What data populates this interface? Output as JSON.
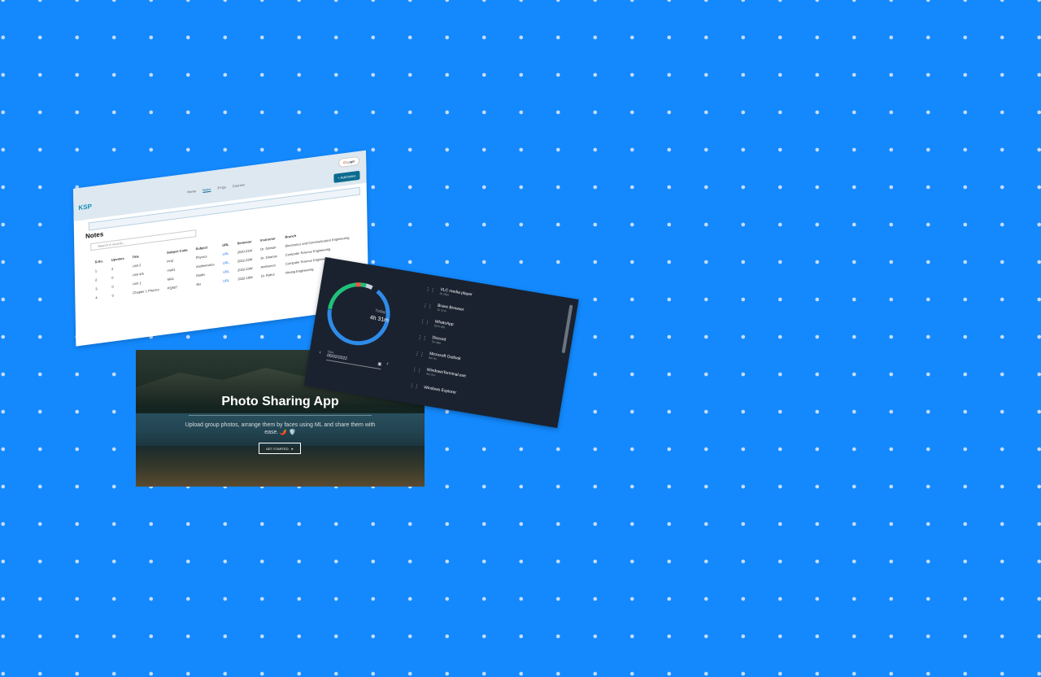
{
  "photo_app": {
    "title": "Photo Sharing App",
    "subtitle": "Upload group photos, arrange them by faces using ML and share them with ease. 🌶️ 🛡️",
    "button": "GET STARTED"
  },
  "notes_app": {
    "logo": "KSP",
    "nav": [
      "Home",
      "Notes",
      "PYQs",
      "Courses"
    ],
    "login": "Login",
    "add_button": "Add Notes",
    "page_title": "Notes",
    "search_placeholder": "Search 4 records...",
    "columns": [
      "S.No.",
      "Upvotes",
      "Title",
      "Subject Code",
      "Subject",
      "URL",
      "Semester",
      "Instructor",
      "Branch"
    ],
    "rows": [
      [
        "1.",
        "2",
        "Unit 2",
        "PH2",
        "Physics",
        "URL",
        "2020-21W",
        "Dr. Gitman",
        "Electronics and Communication Engineering"
      ],
      [
        "2.",
        "0",
        "Unit 4/5",
        "ma01",
        "mathematics",
        "URL",
        "2022-23W",
        "Dr. Ghanan",
        "Computer Science Engineering"
      ],
      [
        "3.",
        "0",
        "Unit 1",
        "MA1",
        "Maths",
        "URL",
        "2022-23W",
        "Anthumon",
        "Computer Science Engineering"
      ],
      [
        "4.",
        "0",
        "Chapter 1 Physics",
        "PQ607",
        "Bio",
        "URL",
        "2022-18W",
        "Dr. Rahul",
        "Mining Engineering"
      ]
    ]
  },
  "screentime_app": {
    "today_label": "Today",
    "total": "4h 31m",
    "date_label": "Date",
    "date_value": "05/02/2022",
    "apps": [
      {
        "name": "VLC media player",
        "time": "2h 28m"
      },
      {
        "name": "Brave Browser",
        "time": "1h 21m"
      },
      {
        "name": "WhatsApp",
        "time": "52m 39s"
      },
      {
        "name": "Discord",
        "time": "7m 48s"
      },
      {
        "name": "Microsoft Outlook",
        "time": "5m 9s"
      },
      {
        "name": "WindowsTerminal.exe",
        "time": "4m 21s"
      },
      {
        "name": "Windows Explorer",
        "time": ""
      }
    ]
  },
  "colors": {
    "background": "#1389fd",
    "ring_primary": "#2f8be8",
    "ring_secondary": "#21c07a"
  }
}
